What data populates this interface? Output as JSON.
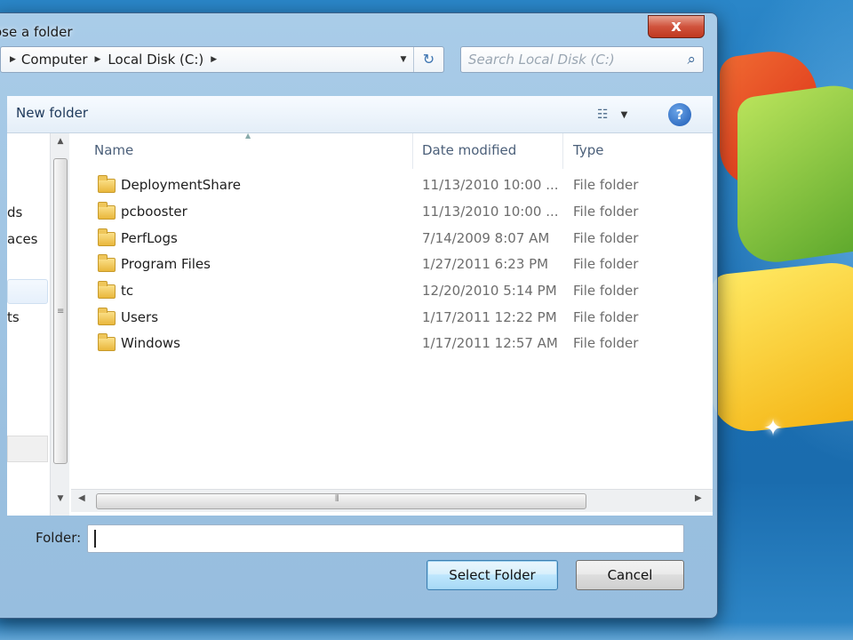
{
  "window": {
    "title": "ose a folder",
    "close_label": "x"
  },
  "address": {
    "crumbs": [
      "Computer",
      "Local Disk (C:)"
    ],
    "search_placeholder": "Search Local Disk (C:)"
  },
  "toolbar": {
    "new_folder_label": "New folder",
    "help_label": "?"
  },
  "nav": {
    "items": [
      "ds",
      "aces",
      "ts"
    ]
  },
  "columns": {
    "name": "Name",
    "date": "Date modified",
    "type": "Type"
  },
  "files": [
    {
      "name": "DeploymentShare",
      "date": "11/13/2010 10:00 ...",
      "type": "File folder"
    },
    {
      "name": "pcbooster",
      "date": "11/13/2010 10:00 ...",
      "type": "File folder"
    },
    {
      "name": "PerfLogs",
      "date": "7/14/2009 8:07 AM",
      "type": "File folder"
    },
    {
      "name": "Program Files",
      "date": "1/27/2011 6:23 PM",
      "type": "File folder"
    },
    {
      "name": "tc",
      "date": "12/20/2010 5:14 PM",
      "type": "File folder"
    },
    {
      "name": "Users",
      "date": "1/17/2011 12:22 PM",
      "type": "File folder"
    },
    {
      "name": "Windows",
      "date": "1/17/2011 12:57 AM",
      "type": "File folder"
    }
  ],
  "folder_field": {
    "label": "Folder:",
    "value": ""
  },
  "buttons": {
    "select": "Select Folder",
    "cancel": "Cancel"
  }
}
